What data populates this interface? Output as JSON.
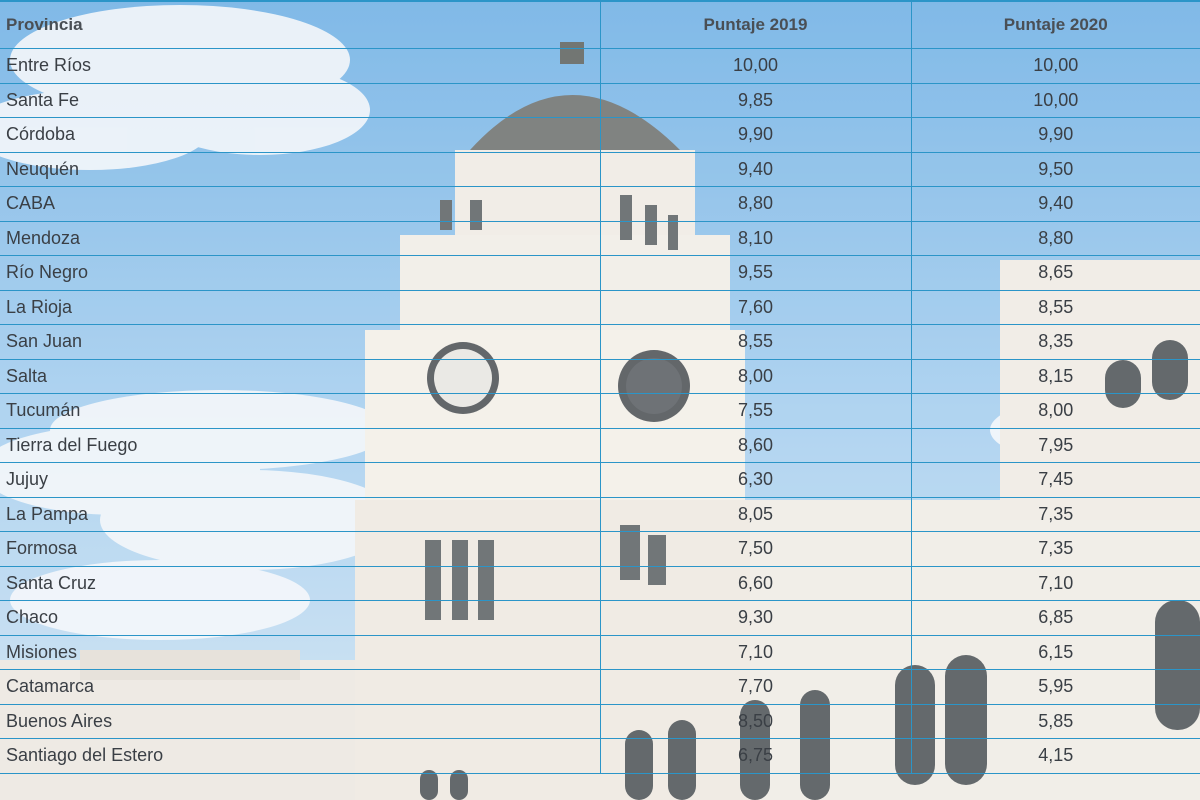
{
  "columns": [
    "Provincia",
    "Puntaje 2019",
    "Puntaje 2020"
  ],
  "rows": [
    {
      "provincia": "Entre Ríos",
      "p2019": "10,00",
      "p2020": "10,00"
    },
    {
      "provincia": "Santa Fe",
      "p2019": "9,85",
      "p2020": "10,00"
    },
    {
      "provincia": "Córdoba",
      "p2019": "9,90",
      "p2020": "9,90"
    },
    {
      "provincia": "Neuquén",
      "p2019": "9,40",
      "p2020": "9,50"
    },
    {
      "provincia": "CABA",
      "p2019": "8,80",
      "p2020": "9,40"
    },
    {
      "provincia": "Mendoza",
      "p2019": "8,10",
      "p2020": "8,80"
    },
    {
      "provincia": "Río Negro",
      "p2019": "9,55",
      "p2020": "8,65"
    },
    {
      "provincia": "La Rioja",
      "p2019": "7,60",
      "p2020": "8,55"
    },
    {
      "provincia": "San Juan",
      "p2019": "8,55",
      "p2020": "8,35"
    },
    {
      "provincia": "Salta",
      "p2019": "8,00",
      "p2020": "8,15"
    },
    {
      "provincia": "Tucumán",
      "p2019": "7,55",
      "p2020": "8,00"
    },
    {
      "provincia": "Tierra del Fuego",
      "p2019": "8,60",
      "p2020": "7,95"
    },
    {
      "provincia": "Jujuy",
      "p2019": "6,30",
      "p2020": "7,45"
    },
    {
      "provincia": "La Pampa",
      "p2019": "8,05",
      "p2020": "7,35"
    },
    {
      "provincia": "Formosa",
      "p2019": "7,50",
      "p2020": "7,35"
    },
    {
      "provincia": "Santa Cruz",
      "p2019": "6,60",
      "p2020": "7,10"
    },
    {
      "provincia": "Chaco",
      "p2019": "9,30",
      "p2020": "6,85"
    },
    {
      "provincia": "Misiones",
      "p2019": "7,10",
      "p2020": "6,15"
    },
    {
      "provincia": "Catamarca",
      "p2019": "7,70",
      "p2020": "5,95"
    },
    {
      "provincia": "Buenos Aires",
      "p2019": "8,50",
      "p2020": "5,85"
    },
    {
      "provincia": "Santiago del Estero",
      "p2019": "6,75",
      "p2020": "4,15"
    }
  ],
  "colors": {
    "grid": "#2b95c8",
    "text": "#3a3f45",
    "sky": "#9cc8ea"
  }
}
